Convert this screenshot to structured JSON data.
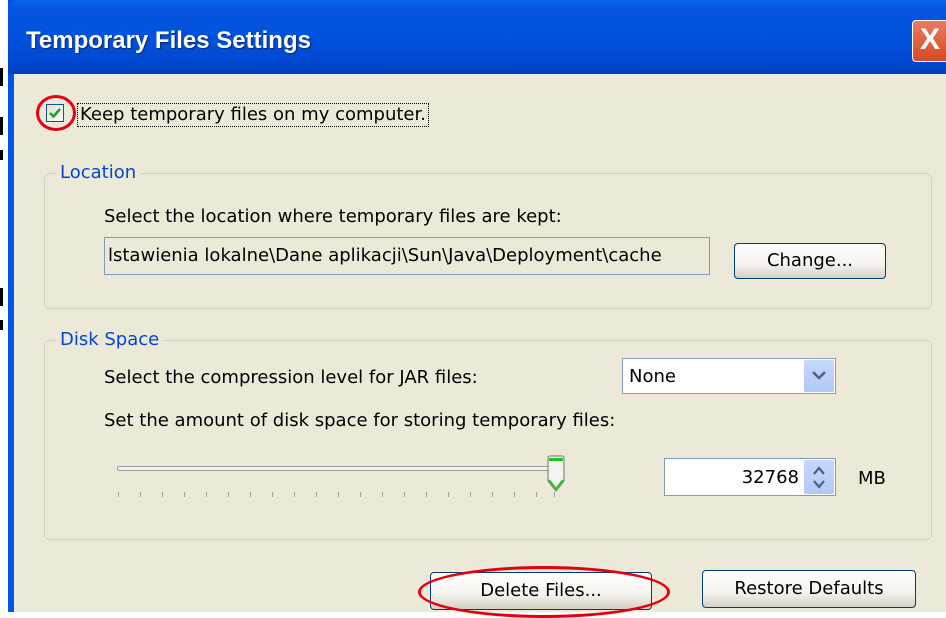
{
  "window": {
    "title": "Temporary Files Settings",
    "close_glyph": "X"
  },
  "keep_files": {
    "label": "Keep temporary files on my computer.",
    "checked": true,
    "highlight_color": "#e4000f"
  },
  "location": {
    "group_label": "Location",
    "instruction": "Select the location where temporary files are kept:",
    "path": "lstawienia lokalne\\Dane aplikacji\\Sun\\Java\\Deployment\\cache",
    "change_button": "Change..."
  },
  "disk_space": {
    "group_label": "Disk Space",
    "compression_label": "Select the compression level for JAR files:",
    "compression_value": "None",
    "amount_label": "Set the amount of disk space for storing temporary files:",
    "amount_value": "32768",
    "unit": "MB",
    "slider_level": 1.0
  },
  "buttons": {
    "delete_files": "Delete Files...",
    "restore_defaults": "Restore Defaults"
  },
  "colors": {
    "titlebar": "#0054e3",
    "dialog_bg": "#ece9d8",
    "group_label": "#0046d5",
    "annotation_red": "#e4000f"
  },
  "icons": {
    "checkbox": "checkmark-icon",
    "close": "close-icon",
    "dropdown": "chevron-down-icon",
    "spinner": "spinner-updown-icon"
  }
}
